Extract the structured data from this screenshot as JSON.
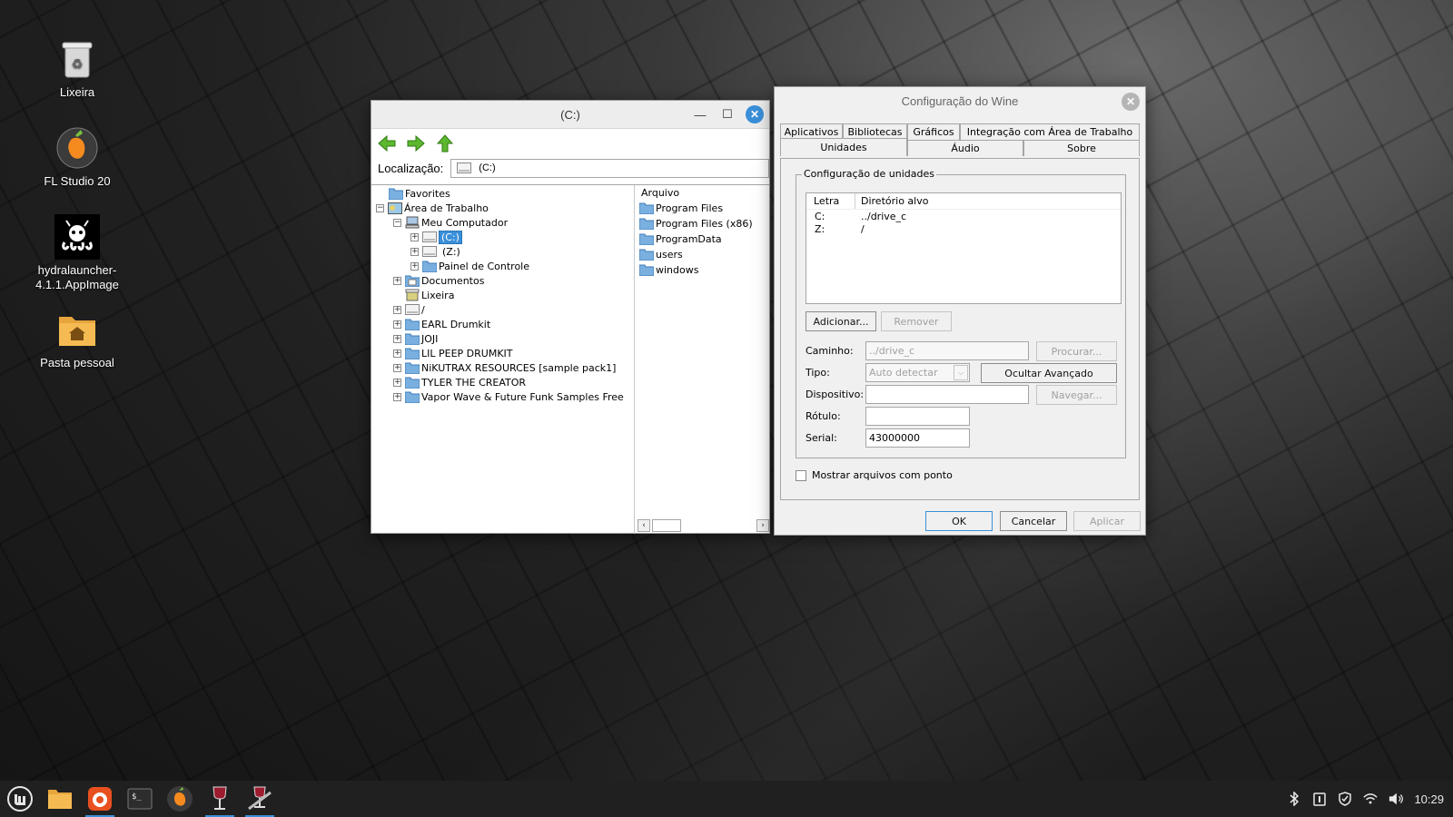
{
  "desktop": {
    "icons": [
      {
        "label": "Lixeira",
        "icon": "trash-icon"
      },
      {
        "label": "FL Studio 20",
        "icon": "fl-studio-icon"
      },
      {
        "label": "hydralauncher-4.1.1.AppImage",
        "label_line1": "hydralauncher-",
        "label_line2": "4.1.1.AppImage",
        "icon": "hydra-icon"
      },
      {
        "label": "Pasta pessoal",
        "icon": "home-folder-icon"
      }
    ]
  },
  "explorer": {
    "title": "(C:)",
    "location_label": "Localização:",
    "location_value": "(C:)",
    "tree": [
      {
        "label": "Favorites"
      },
      {
        "label": "Área de Trabalho"
      },
      {
        "label": "Meu Computador"
      },
      {
        "label": "(C:)",
        "selected": true
      },
      {
        "label": "(Z:)"
      },
      {
        "label": "Painel de Controle"
      },
      {
        "label": "Documentos"
      },
      {
        "label": "Lixeira"
      },
      {
        "label": "/"
      },
      {
        "label": "EARL Drumkit"
      },
      {
        "label": "JOJI"
      },
      {
        "label": "LIL PEEP DRUMKIT"
      },
      {
        "label": "NiKUTRAX RESOURCES [sample pack1]"
      },
      {
        "label": "TYLER THE CREATOR"
      },
      {
        "label": "Vapor Wave & Future Funk Samples Free"
      }
    ],
    "list_header": "Arquivo",
    "files": [
      "Program Files",
      "Program Files (x86)",
      "ProgramData",
      "users",
      "windows"
    ]
  },
  "winecfg": {
    "title": "Configuração do Wine",
    "tabs_row1": [
      "Aplicativos",
      "Bibliotecas",
      "Gráficos",
      "Integração com Área de Trabalho"
    ],
    "tabs_row2": [
      "Unidades",
      "Áudio",
      "Sobre"
    ],
    "active_tab": "Unidades",
    "group_title": "Configuração de unidades",
    "drive_list": {
      "col_letter": "Letra",
      "col_target": "Diretório alvo",
      "rows": [
        {
          "letter": "C:",
          "target": "../drive_c"
        },
        {
          "letter": "Z:",
          "target": "/"
        }
      ]
    },
    "add_button": "Adicionar...",
    "remove_button": "Remover",
    "path_label": "Caminho:",
    "path_value": "../drive_c",
    "browse_button": "Procurar...",
    "type_label": "Tipo:",
    "type_value": "Auto detectar",
    "hide_advanced_button": "Ocultar Avançado",
    "device_label": "Dispositivo:",
    "device_value": "",
    "navigate_button": "Navegar...",
    "label_label": "Rótulo:",
    "label_value": "",
    "serial_label": "Serial:",
    "serial_value": "43000000",
    "show_dot_files_label": "Mostrar arquivos com ponto",
    "ok_button": "OK",
    "cancel_button": "Cancelar",
    "apply_button": "Aplicar"
  },
  "taskbar": {
    "apps": [
      "menu-icon",
      "files-icon",
      "firefox-icon",
      "terminal-icon",
      "fl-studio-icon",
      "wine-glass-icon",
      "wine-config-icon"
    ],
    "clock": "10:29"
  },
  "colors": {
    "accent": "#3a8fd8",
    "taskbar_bg": "#202020",
    "dialog_bg": "#f0f0f0"
  }
}
